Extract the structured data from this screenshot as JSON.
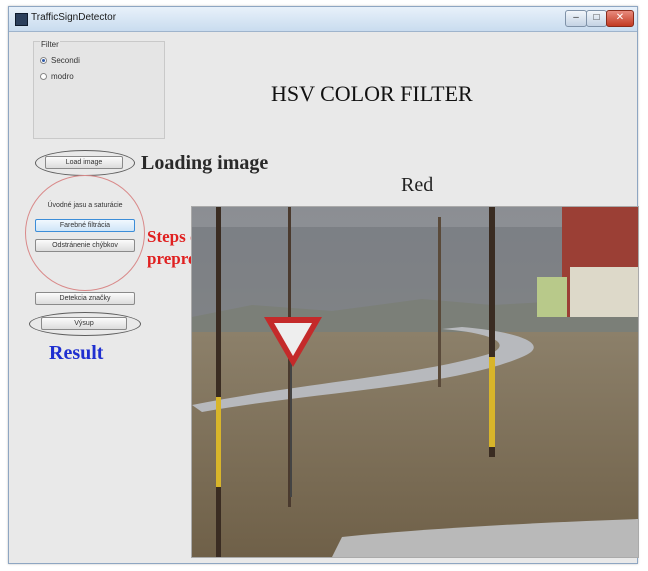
{
  "window": {
    "title": "TrafficSignDetector"
  },
  "filter_group": {
    "label": "Filter",
    "options": [
      {
        "label": "Secondi",
        "selected": true
      },
      {
        "label": "modro",
        "selected": false
      }
    ]
  },
  "heading": "HSV COLOR FILTER",
  "buttons": {
    "load_image": "Load image",
    "preprocess_header": "Úvodné jasu a saturácie",
    "step1": "Farebné filtrácia",
    "step2": "Odstránenie chýbkov",
    "detect": "Detekcia značky",
    "result": "Výsup"
  },
  "annotations": {
    "loading": "Loading image",
    "steps_line1": "Steps of",
    "steps_line2": "preprocessing",
    "result": "Result"
  },
  "image_label": "Red",
  "colors": {
    "annotation_red": "#e02020",
    "annotation_blue": "#1f2fd0",
    "titlebar": "#c9dcef"
  }
}
